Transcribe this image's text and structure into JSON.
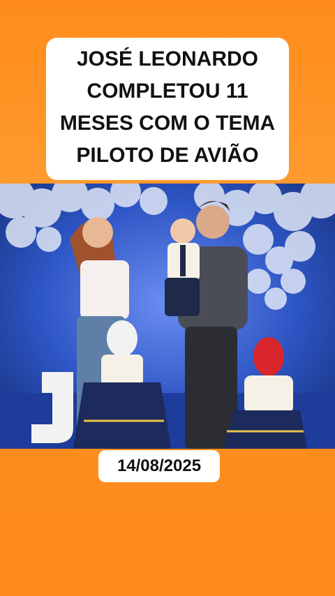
{
  "headline": {
    "lines": [
      "JOSÉ LEONARDO",
      "COMPLETOU 11",
      "MESES COM O TEMA",
      "PILOTO DE AVIÃO"
    ]
  },
  "photo": {
    "subject": "party-photo"
  },
  "date": "14/08/2025",
  "colors": {
    "background": "#ff8c1a",
    "box": "#ffffff",
    "text": "#111111"
  }
}
